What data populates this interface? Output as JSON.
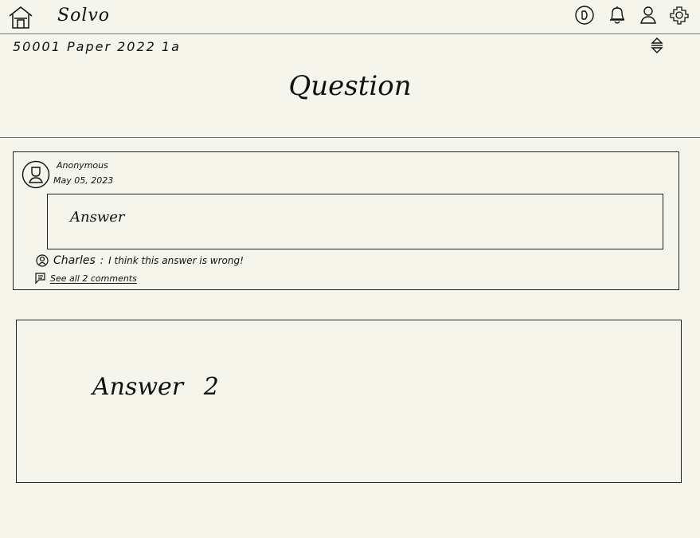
{
  "app": {
    "name": "Solvo"
  },
  "header": {
    "icons": [
      "home-icon",
      "coin-icon",
      "bell-icon",
      "profile-icon",
      "settings-icon"
    ]
  },
  "question": {
    "subtitle": "50001 Paper 2022 1a",
    "title": "Question"
  },
  "answers": [
    {
      "author": "Anonymous",
      "date": "May 05, 2023",
      "body": "Answer",
      "comment": {
        "author": "Charles",
        "separator": ":",
        "text": "I think this answer is wrong!"
      },
      "see_comments_label": "See all 2 comments"
    },
    {
      "body": "Answer 2"
    }
  ]
}
